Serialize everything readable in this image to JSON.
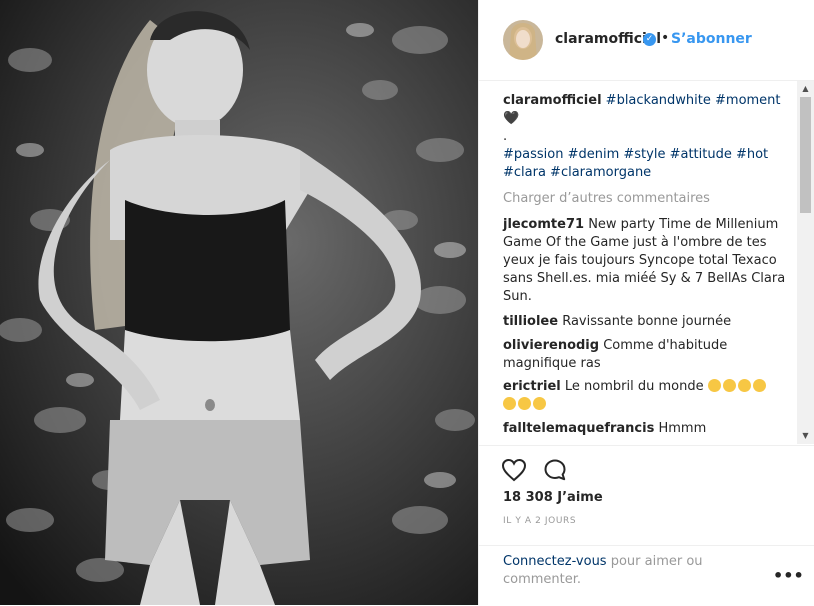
{
  "post": {
    "username": "claramofficiel",
    "verified_glyph": "✓",
    "dot": "•",
    "follow_label": "S’abonner"
  },
  "caption": {
    "username": "claramofficiel",
    "tags_line1": "#blackandwhite #moment",
    "heart": "🖤",
    "dot": ".",
    "tags_line2": "#passion #denim #style #attitude #hot",
    "tags_line3": "#clara #claramorgane"
  },
  "load_more": "Charger d’autres commentaires",
  "comments": [
    {
      "user": "jlecomte71",
      "text": "New party Time de Millenium Game Of the Game just à l'ombre de tes yeux je fais toujours Syncope total Texaco sans Shell.es. mia miéé Sy & 7 BellAs Clara Sun."
    },
    {
      "user": "tilliolee",
      "text": "Ravissante bonne journée"
    },
    {
      "user": "olivierenodig",
      "text": "Comme d'habitude magnifique ras"
    },
    {
      "user": "erictriel",
      "text": "Le nombril du monde"
    },
    {
      "user": "falltelemaquefrancis",
      "text": "Hmmm"
    }
  ],
  "scroll": {
    "up": "▲",
    "down": "▼"
  },
  "actions": {
    "like_icon": "heart-icon",
    "comment_icon": "comment-icon"
  },
  "likes": "18 308 J’aime",
  "timestamp": "IL Y A 2 JOURS",
  "footer": {
    "login_link": "Connectez-vous",
    "login_rest": " pour aimer ou commenter.",
    "more": "•••"
  },
  "colors": {
    "accent": "#3897f0",
    "hashtag": "#003569",
    "muted": "#999999",
    "text": "#262626"
  }
}
